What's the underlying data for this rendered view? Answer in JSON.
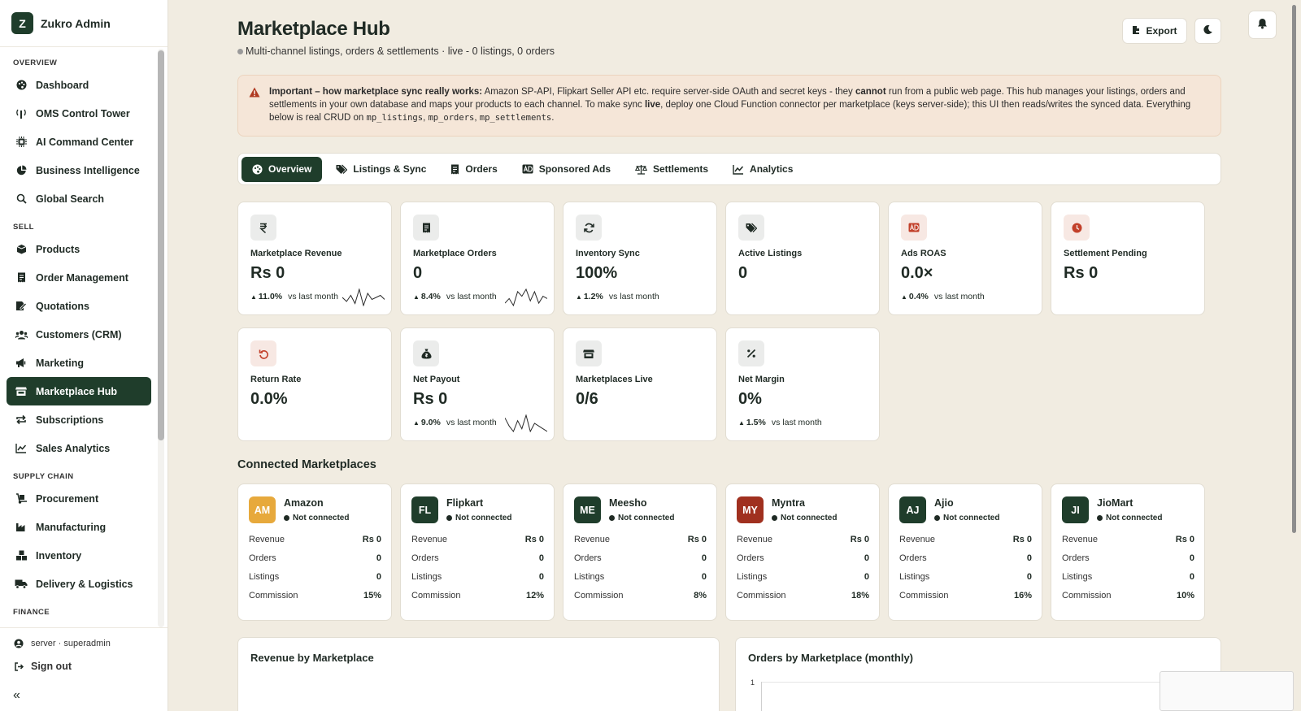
{
  "brand": {
    "logo": "Z",
    "name": "Zukro Admin"
  },
  "sidebar": {
    "sections": [
      {
        "title": "OVERVIEW",
        "items": [
          {
            "label": "Dashboard",
            "icon": "palette-icon",
            "active": false
          },
          {
            "label": "OMS Control Tower",
            "icon": "tower-icon",
            "active": false
          },
          {
            "label": "AI Command Center",
            "icon": "chip-icon",
            "active": false
          },
          {
            "label": "Business Intelligence",
            "icon": "pie-chart-icon",
            "active": false
          },
          {
            "label": "Global Search",
            "icon": "search-icon",
            "active": false
          }
        ]
      },
      {
        "title": "SELL",
        "items": [
          {
            "label": "Products",
            "icon": "box-icon",
            "active": false
          },
          {
            "label": "Order Management",
            "icon": "receipt-icon",
            "active": false
          },
          {
            "label": "Quotations",
            "icon": "edit-doc-icon",
            "active": false
          },
          {
            "label": "Customers (CRM)",
            "icon": "users-icon",
            "active": false
          },
          {
            "label": "Marketing",
            "icon": "megaphone-icon",
            "active": false
          },
          {
            "label": "Marketplace Hub",
            "icon": "store-icon",
            "active": true
          },
          {
            "label": "Subscriptions",
            "icon": "repeat-icon",
            "active": false
          },
          {
            "label": "Sales Analytics",
            "icon": "line-chart-icon",
            "active": false
          }
        ]
      },
      {
        "title": "SUPPLY CHAIN",
        "items": [
          {
            "label": "Procurement",
            "icon": "dolly-icon",
            "active": false
          },
          {
            "label": "Manufacturing",
            "icon": "industry-icon",
            "active": false
          },
          {
            "label": "Inventory",
            "icon": "boxes-icon",
            "active": false
          },
          {
            "label": "Delivery & Logistics",
            "icon": "truck-icon",
            "active": false
          }
        ]
      },
      {
        "title": "FINANCE",
        "items": []
      }
    ],
    "footer": {
      "user": "server · superadmin",
      "signout": "Sign out",
      "collapse": "«"
    }
  },
  "header": {
    "title": "Marketplace Hub",
    "subtitle": "Multi-channel listings, orders & settlements · live - 0 listings, 0 orders",
    "export_label": "Export"
  },
  "notice": {
    "lead": "Important – how marketplace sync really works:",
    "part1": " Amazon SP-API, Flipkart Seller API etc. require server-side OAuth and secret keys - they ",
    "emph1": "cannot",
    "part2": " run from a public web page. This hub manages your listings, orders and settlements in your own database and maps your products to each channel. To make sync ",
    "emph2": "live",
    "part3": ", deploy one Cloud Function connector per marketplace (keys server-side); this UI then reads/writes the synced data. Everything below is real CRUD on ",
    "code1": "mp_listings",
    "sep1": ", ",
    "code2": "mp_orders",
    "sep2": ", ",
    "code3": "mp_settlements",
    "end": "."
  },
  "tabs": [
    {
      "label": "Overview",
      "icon": "palette-icon",
      "active": true
    },
    {
      "label": "Listings & Sync",
      "icon": "tags-icon",
      "active": false
    },
    {
      "label": "Orders",
      "icon": "receipt-icon",
      "active": false
    },
    {
      "label": "Sponsored Ads",
      "icon": "ad-icon",
      "active": false
    },
    {
      "label": "Settlements",
      "icon": "scale-icon",
      "active": false
    },
    {
      "label": "Analytics",
      "icon": "line-chart-icon",
      "active": false
    }
  ],
  "kpis": [
    {
      "label": "Marketplace Revenue",
      "value": "Rs 0",
      "delta": "11.0%",
      "delta_text": "vs last month",
      "icon": "rupee-icon",
      "accent": "#1f2a24",
      "spark": [
        5,
        3,
        6,
        2,
        9,
        1,
        7,
        4,
        5,
        6,
        4
      ]
    },
    {
      "label": "Marketplace Orders",
      "value": "0",
      "delta": "8.4%",
      "delta_text": "vs last month",
      "icon": "receipt-icon",
      "accent": "#1f2a24",
      "spark": [
        3,
        5,
        2,
        8,
        6,
        9,
        4,
        8,
        3,
        6,
        5
      ]
    },
    {
      "label": "Inventory Sync",
      "value": "100%",
      "delta": "1.2%",
      "delta_text": "vs last month",
      "icon": "sync-icon",
      "accent": "#1f2a24",
      "spark": []
    },
    {
      "label": "Active Listings",
      "value": "0",
      "delta": "",
      "delta_text": "",
      "icon": "tags-icon",
      "accent": "#1f2a24",
      "spark": []
    },
    {
      "label": "Ads ROAS",
      "value": "0.0×",
      "delta": "0.4%",
      "delta_text": "vs last month",
      "icon": "ad-icon",
      "accent": "#c2402a",
      "spark": []
    },
    {
      "label": "Settlement Pending",
      "value": "Rs 0",
      "delta": "",
      "delta_text": "",
      "icon": "clock-icon",
      "accent": "#c2402a",
      "spark": []
    },
    {
      "label": "Return Rate",
      "value": "0.0%",
      "delta": "",
      "delta_text": "",
      "icon": "undo-icon",
      "accent": "#c2402a",
      "spark": []
    },
    {
      "label": "Net Payout",
      "value": "Rs 0",
      "delta": "9.0%",
      "delta_text": "vs last month",
      "icon": "money-bag-icon",
      "accent": "#1f2a24",
      "spark": [
        7,
        4,
        2,
        6,
        3,
        8,
        2,
        5,
        4,
        3,
        2
      ]
    },
    {
      "label": "Marketplaces Live",
      "value": "0/6",
      "delta": "",
      "delta_text": "",
      "icon": "store-icon",
      "accent": "#1f2a24",
      "spark": []
    },
    {
      "label": "Net Margin",
      "value": "0%",
      "delta": "1.5%",
      "delta_text": "vs last month",
      "icon": "percent-icon",
      "accent": "#1f2a24",
      "spark": []
    }
  ],
  "connected_title": "Connected Marketplaces",
  "marketplaces": [
    {
      "abbr": "AM",
      "name": "Amazon",
      "status": "Not connected",
      "color": "#e7a93c",
      "revenue": "Rs 0",
      "orders": "0",
      "listings": "0",
      "commission": "15%"
    },
    {
      "abbr": "FL",
      "name": "Flipkart",
      "status": "Not connected",
      "color": "#1f3d2b",
      "revenue": "Rs 0",
      "orders": "0",
      "listings": "0",
      "commission": "12%"
    },
    {
      "abbr": "ME",
      "name": "Meesho",
      "status": "Not connected",
      "color": "#1f3d2b",
      "revenue": "Rs 0",
      "orders": "0",
      "listings": "0",
      "commission": "8%"
    },
    {
      "abbr": "MY",
      "name": "Myntra",
      "status": "Not connected",
      "color": "#a0301f",
      "revenue": "Rs 0",
      "orders": "0",
      "listings": "0",
      "commission": "18%"
    },
    {
      "abbr": "AJ",
      "name": "Ajio",
      "status": "Not connected",
      "color": "#1f3d2b",
      "revenue": "Rs 0",
      "orders": "0",
      "listings": "0",
      "commission": "16%"
    },
    {
      "abbr": "JI",
      "name": "JioMart",
      "status": "Not connected",
      "color": "#1f3d2b",
      "revenue": "Rs 0",
      "orders": "0",
      "listings": "0",
      "commission": "10%"
    }
  ],
  "row_labels": {
    "revenue": "Revenue",
    "orders": "Orders",
    "listings": "Listings",
    "commission": "Commission"
  },
  "panels": {
    "revenue_title": "Revenue by Marketplace",
    "orders_title": "Orders by Marketplace (monthly)",
    "orders_y_tick": "1"
  }
}
